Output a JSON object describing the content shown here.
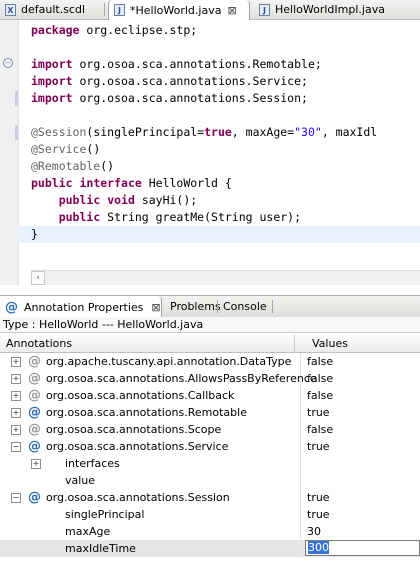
{
  "editor_tabs": [
    {
      "icon": "X",
      "label": "default.scdl",
      "active": false
    },
    {
      "icon": "J",
      "label": "*HelloWorld.java",
      "active": true,
      "close": "⊠"
    },
    {
      "icon": "J",
      "label": "HelloWorldImpl.java",
      "active": false
    }
  ],
  "code_lines": [
    [
      {
        "t": "package",
        "c": "kw"
      },
      {
        "t": " org.eclipse.stp;"
      }
    ],
    [],
    [
      {
        "t": "import",
        "c": "kw"
      },
      {
        "t": " org.osoa.sca.annotations.Remotable;"
      }
    ],
    [
      {
        "t": "import",
        "c": "kw"
      },
      {
        "t": " org.osoa.sca.annotations.Service;"
      }
    ],
    [
      {
        "t": "import",
        "c": "kw"
      },
      {
        "t": " org.osoa.sca.annotations.Session;"
      }
    ],
    [],
    [
      {
        "t": "@Session",
        "c": "ann"
      },
      {
        "t": "(singlePrincipal="
      },
      {
        "t": "true",
        "c": "kw"
      },
      {
        "t": ", maxAge="
      },
      {
        "t": "\"30\"",
        "c": "str"
      },
      {
        "t": ", maxIdl"
      }
    ],
    [
      {
        "t": "@Service",
        "c": "ann"
      },
      {
        "t": "()"
      }
    ],
    [
      {
        "t": "@Remotable",
        "c": "ann"
      },
      {
        "t": "()"
      }
    ],
    [
      {
        "t": "public",
        "c": "kw"
      },
      {
        "t": " "
      },
      {
        "t": "interface",
        "c": "kw"
      },
      {
        "t": " HelloWorld {"
      }
    ],
    [
      {
        "t": "    "
      },
      {
        "t": "public",
        "c": "kw"
      },
      {
        "t": " "
      },
      {
        "t": "void",
        "c": "kw"
      },
      {
        "t": " sayHi();"
      }
    ],
    [
      {
        "t": "    "
      },
      {
        "t": "public",
        "c": "kw"
      },
      {
        "t": " String greatMe(String user);"
      }
    ],
    [
      {
        "t": "}"
      }
    ]
  ],
  "view_tabs": [
    {
      "label": "Annotation Properties",
      "active": true,
      "close": "⊠"
    },
    {
      "label": "Problems",
      "active": false
    },
    {
      "label": "Console",
      "active": false
    }
  ],
  "type_line": "Type : HelloWorld --- HelloWorld.java",
  "columns": {
    "annotations": "Annotations",
    "values": "Values"
  },
  "rows": [
    {
      "level": 0,
      "expander": "+",
      "icon": "grey",
      "name": "org.apache.tuscany.api.annotation.DataType",
      "value": "false"
    },
    {
      "level": 0,
      "expander": "+",
      "icon": "grey",
      "name": "org.osoa.sca.annotations.AllowsPassByReference",
      "value": "false"
    },
    {
      "level": 0,
      "expander": "+",
      "icon": "grey",
      "name": "org.osoa.sca.annotations.Callback",
      "value": "false"
    },
    {
      "level": 0,
      "expander": "+",
      "icon": "blue",
      "name": "org.osoa.sca.annotations.Remotable",
      "value": "true"
    },
    {
      "level": 0,
      "expander": "+",
      "icon": "grey",
      "name": "org.osoa.sca.annotations.Scope",
      "value": "false"
    },
    {
      "level": 0,
      "expander": "−",
      "icon": "blue",
      "name": "org.osoa.sca.annotations.Service",
      "value": "true"
    },
    {
      "level": 1,
      "expander": "+",
      "icon": "",
      "name": "interfaces",
      "value": ""
    },
    {
      "level": 1,
      "expander": "",
      "icon": "",
      "name": "value",
      "value": ""
    },
    {
      "level": 0,
      "expander": "−",
      "icon": "blue",
      "name": "org.osoa.sca.annotations.Session",
      "value": "true"
    },
    {
      "level": 1,
      "expander": "",
      "icon": "",
      "name": "singlePrincipal",
      "value": "true"
    },
    {
      "level": 1,
      "expander": "",
      "icon": "",
      "name": "maxAge",
      "value": "30"
    },
    {
      "level": 1,
      "expander": "",
      "icon": "",
      "name": "maxIdleTime",
      "value": "300",
      "editing": true,
      "selected": true
    }
  ],
  "colors": {
    "keyword": "#7f0055",
    "annotation": "#646464",
    "string": "#2a00ff",
    "annotation_icon": "#2b6bb0"
  },
  "icons": {
    "annotation": "at-sign-icon",
    "expand": "plus-box-icon",
    "collapse": "minus-box-icon"
  }
}
